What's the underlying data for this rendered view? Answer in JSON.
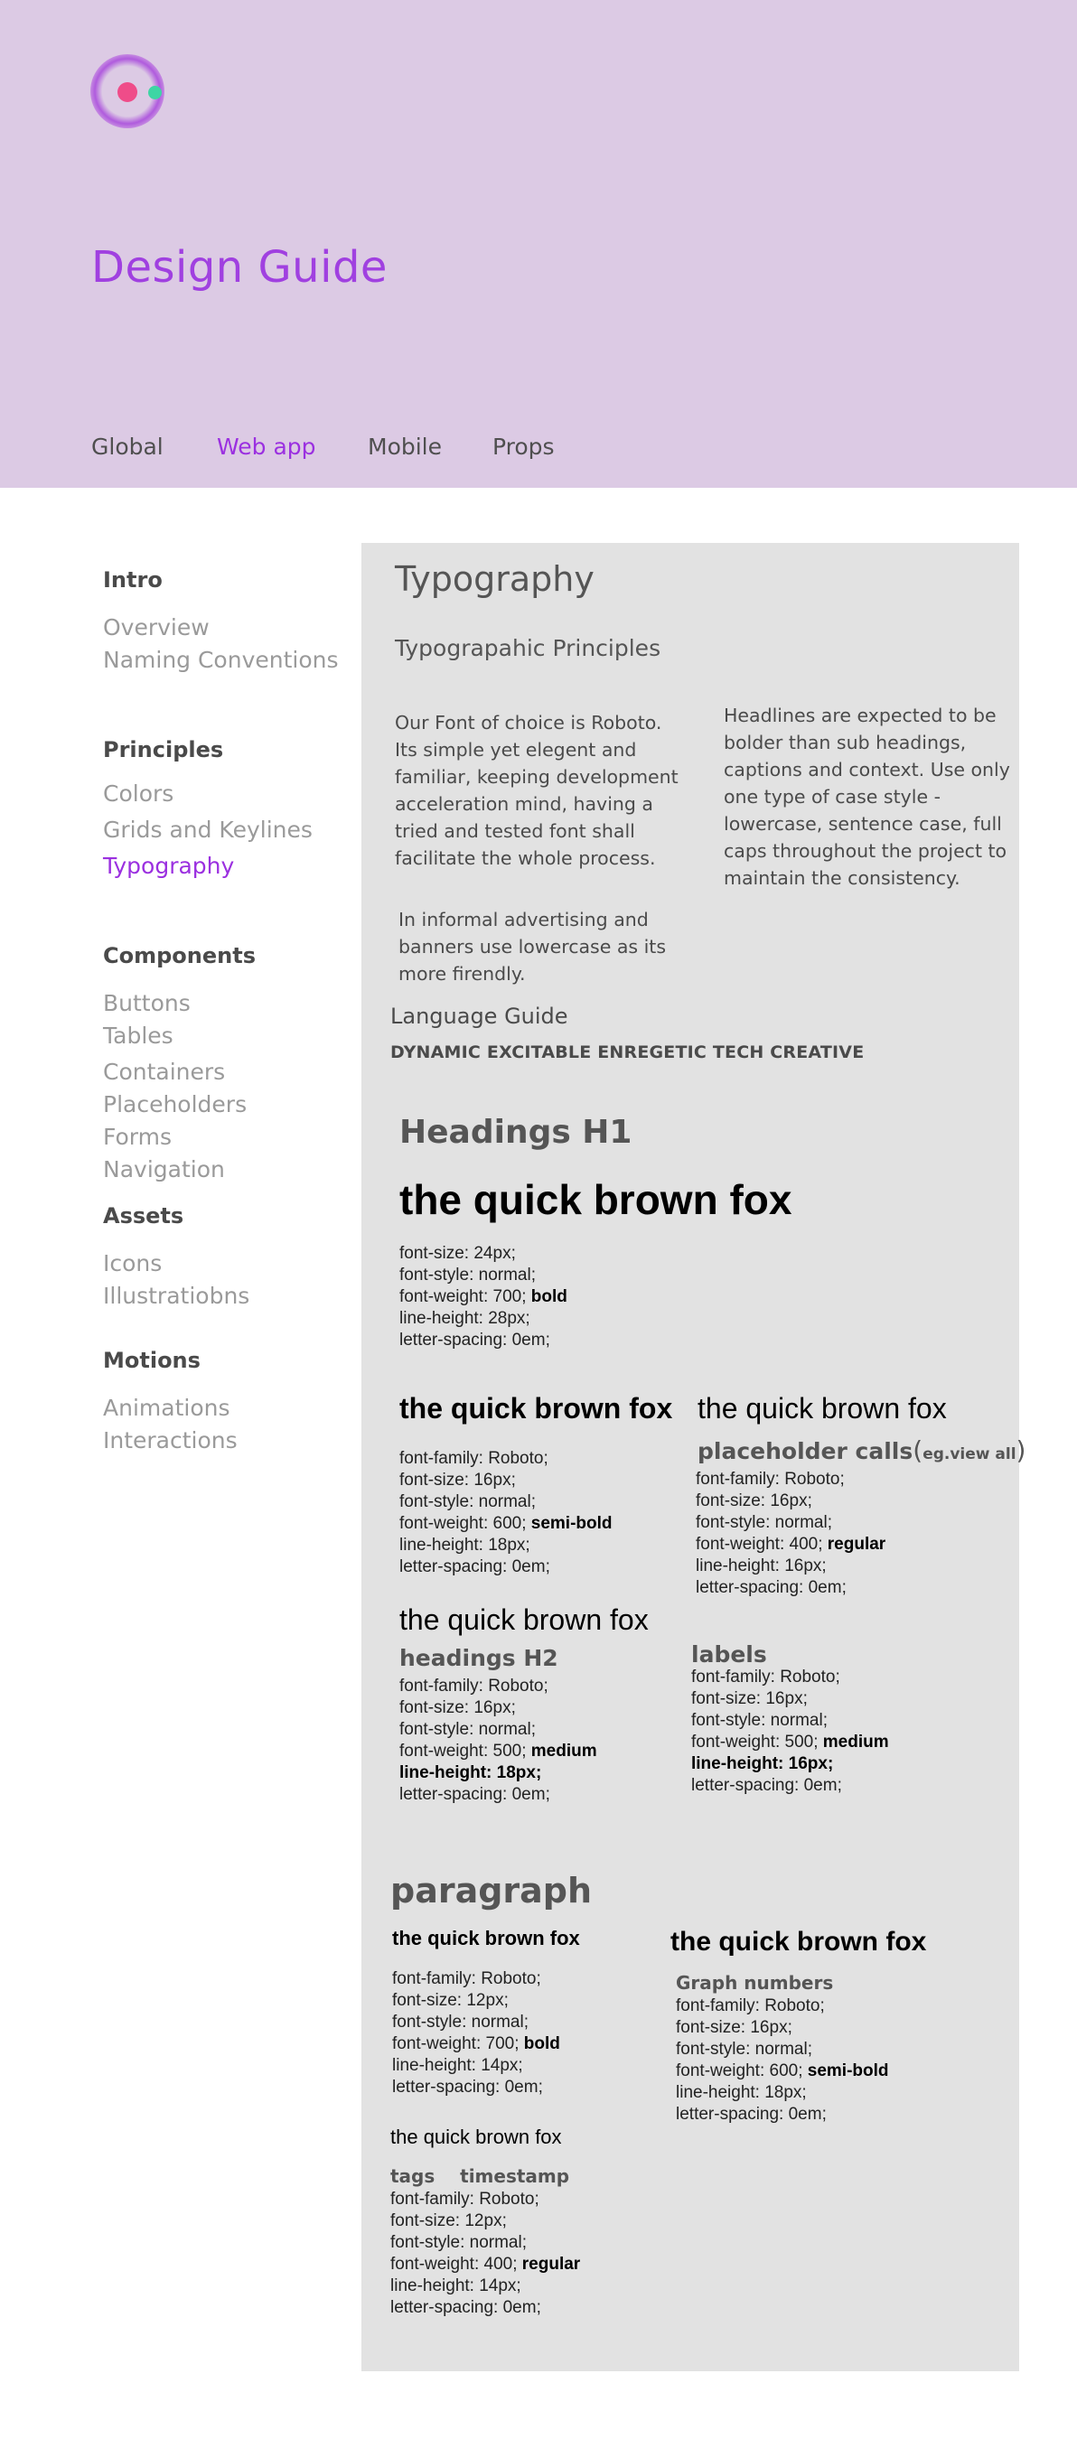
{
  "header": {
    "title": "Design Guide",
    "nav": [
      "Global",
      "Web app",
      "Mobile",
      "Props"
    ],
    "active_nav": "Web app"
  },
  "sidebar": {
    "intro": {
      "heading": "Intro",
      "items": [
        "Overview",
        "Naming Conventions"
      ]
    },
    "principles": {
      "heading": "Principles",
      "items": [
        "Colors",
        "Grids and Keylines",
        "Typography"
      ]
    },
    "components": {
      "heading": "Components",
      "items": [
        "Buttons",
        "Tables",
        "Containers",
        "Placeholders",
        "Forms",
        "Navigation"
      ]
    },
    "assets": {
      "heading": "Assets",
      "items": [
        "Icons",
        "Illustratiobns"
      ]
    },
    "motions": {
      "heading": "Motions",
      "items": [
        "Animations",
        "Interactions"
      ]
    },
    "active_item": "Typography"
  },
  "content": {
    "title": "Typography",
    "subtitle": "Typograpahic Principles",
    "para_left": "Our Font of choice is Roboto. Its simple yet elegent and familiar, keeping development acceleration mind, having a tried and tested font shall facilitate the whole process.",
    "para_left2": "In informal advertising and banners use lowercase as its more firendly.",
    "para_right": "Headlines are expected to be bolder than sub headings, captions and context. Use only one type of case style - lowercase, sentence case, full caps throughout the project to maintain the consistency.",
    "language_guide": "Language Guide",
    "language_words": "DYNAMIC EXCITABLE ENREGETIC TECH CREATIVE",
    "sample": "the quick brown fox",
    "h1": {
      "label": "Headings H1",
      "specs": [
        "font-size: 24px;",
        "font-style: normal;",
        "font-weight: 700;",
        "line-height: 28px;",
        "letter-spacing: 0em;"
      ],
      "weight_word": "bold"
    },
    "sub_headings": {
      "specs": [
        "font-family: Roboto;",
        "font-size: 16px;",
        "font-style: normal;",
        "font-weight: 600;",
        "line-height: 18px;",
        "letter-spacing: 0em;"
      ],
      "weight_word": "semi-bold"
    },
    "placeholder": {
      "label": "placeholder  calls",
      "paren_open": "(",
      "paren_text": "eg.view all",
      "paren_close": ")",
      "specs": [
        "font-family: Roboto;",
        "font-size: 16px;",
        "font-style: normal;",
        "font-weight: 400;",
        "line-height: 16px;",
        "letter-spacing: 0em;"
      ],
      "weight_word": "regular"
    },
    "h2": {
      "label": "headings H2",
      "specs": [
        "font-family: Roboto;",
        "font-size: 16px;",
        "font-style: normal;",
        "font-weight: 500;",
        "line-height: 18px;",
        "letter-spacing: 0em;"
      ],
      "weight_word": "medium"
    },
    "labels": {
      "label": "labels",
      "specs": [
        "font-family: Roboto;",
        "font-size: 16px;",
        "font-style: normal;",
        "font-weight: 500;",
        "line-height: 16px;",
        "letter-spacing: 0em;"
      ],
      "weight_word": "medium"
    },
    "paragraph": {
      "label": "paragraph",
      "specs": [
        "font-family: Roboto;",
        "font-size: 12px;",
        "font-style: normal;",
        "font-weight: 700;",
        "line-height: 14px;",
        "letter-spacing: 0em;"
      ],
      "weight_word": "bold"
    },
    "graph": {
      "label": "Graph numbers",
      "specs": [
        "font-family: Roboto;",
        "font-size: 16px;",
        "font-style: normal;",
        "font-weight: 600;",
        "line-height: 18px;",
        "letter-spacing: 0em;"
      ],
      "weight_word": "semi-bold"
    },
    "tags": {
      "label": "tags    timestamp",
      "specs": [
        "font-family: Roboto;",
        "font-size: 12px;",
        "font-style: normal;",
        "font-weight: 400;",
        "line-height: 14px;",
        "letter-spacing: 0em;"
      ],
      "weight_word": "regular"
    }
  },
  "colors": {
    "header_bg": "#dccae4",
    "accent": "#9b30e0",
    "panel_bg": "#e2e2e2",
    "logo_pink": "#ef4c89",
    "logo_green": "#3ed5a4"
  }
}
